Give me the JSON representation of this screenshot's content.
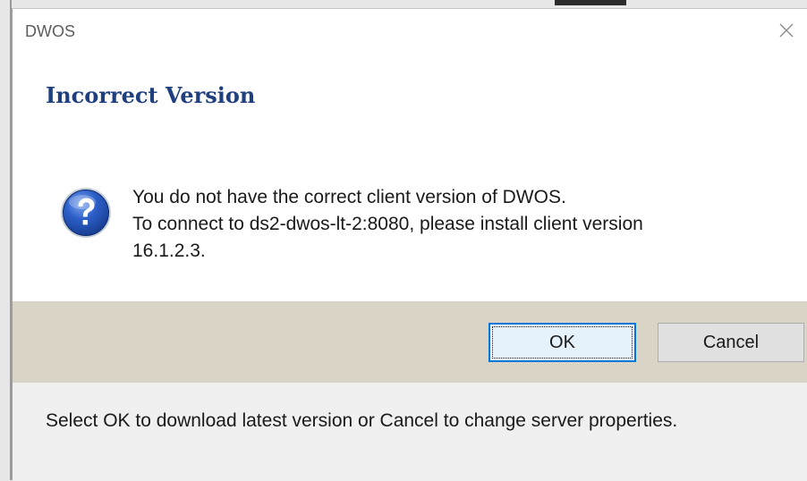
{
  "window": {
    "title": "DWOS",
    "close_symbol": "✕"
  },
  "dialog": {
    "main_instruction": "Incorrect Version",
    "icon": "question-icon",
    "message_lines": [
      "You do not have the correct client version of DWOS.",
      "To connect to ds2-dwos-lt-2:8080, please install client version",
      "16.1.2.3."
    ]
  },
  "buttons": {
    "ok_label": "OK",
    "cancel_label": "Cancel"
  },
  "footer": {
    "text": "Select OK to download latest version or Cancel to change server properties."
  },
  "colors": {
    "main_instruction": "#1f3f7f",
    "button_bar": "#d9d4c5",
    "footer": "#f0f0f0",
    "ok_border": "#0078d7"
  }
}
